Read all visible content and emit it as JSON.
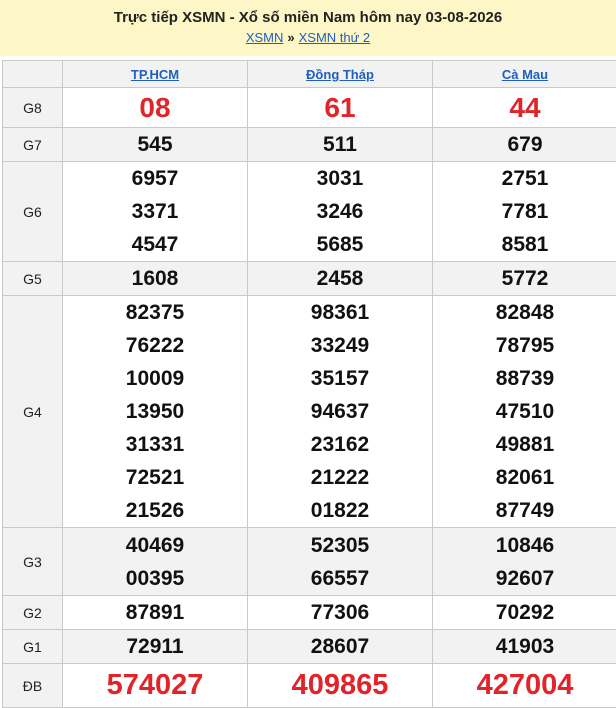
{
  "header": {
    "title": "Trực tiếp XSMN - Xổ số miền Nam hôm nay 03-08-2026",
    "crumb1": "XSMN",
    "sep": "»",
    "crumb2": "XSMN thứ 2"
  },
  "columns": [
    "TP.HCM",
    "Đồng Tháp",
    "Cà Mau"
  ],
  "rows": [
    {
      "label": "G8",
      "values": [
        [
          "08"
        ],
        [
          "61"
        ],
        [
          "44"
        ]
      ]
    },
    {
      "label": "G7",
      "values": [
        [
          "545"
        ],
        [
          "511"
        ],
        [
          "679"
        ]
      ]
    },
    {
      "label": "G6",
      "values": [
        [
          "6957",
          "3371",
          "4547"
        ],
        [
          "3031",
          "3246",
          "5685"
        ],
        [
          "2751",
          "7781",
          "8581"
        ]
      ]
    },
    {
      "label": "G5",
      "values": [
        [
          "1608"
        ],
        [
          "2458"
        ],
        [
          "5772"
        ]
      ]
    },
    {
      "label": "G4",
      "values": [
        [
          "82375",
          "76222",
          "10009",
          "13950",
          "31331",
          "72521",
          "21526"
        ],
        [
          "98361",
          "33249",
          "35157",
          "94637",
          "23162",
          "21222",
          "01822"
        ],
        [
          "82848",
          "78795",
          "88739",
          "47510",
          "49881",
          "82061",
          "87749"
        ]
      ]
    },
    {
      "label": "G3",
      "values": [
        [
          "40469",
          "00395"
        ],
        [
          "52305",
          "66557"
        ],
        [
          "10846",
          "92607"
        ]
      ]
    },
    {
      "label": "G2",
      "values": [
        [
          "87891"
        ],
        [
          "77306"
        ],
        [
          "70292"
        ]
      ]
    },
    {
      "label": "G1",
      "values": [
        [
          "72911"
        ],
        [
          "28607"
        ],
        [
          "41903"
        ]
      ]
    },
    {
      "label": "ĐB",
      "values": [
        [
          "574027"
        ],
        [
          "409865"
        ],
        [
          "427004"
        ]
      ]
    }
  ],
  "colors": {
    "header_bg": "#fdf6c7",
    "special_red": "#e0242a",
    "link_blue": "#1f5fbf"
  }
}
